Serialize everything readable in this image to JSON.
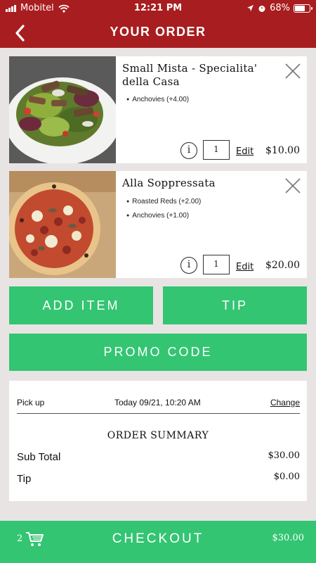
{
  "status_bar": {
    "carrier": "Mobitel",
    "time": "12:21 PM",
    "battery": "68%"
  },
  "header": {
    "title": "YOUR ORDER",
    "back_icon": "chevron-left-icon"
  },
  "cart_items": [
    {
      "name": "Small Mista - Specialita' della Casa",
      "modifiers": [
        "Anchovies (+4.00)"
      ],
      "quantity": "1",
      "edit_label": "Edit",
      "price": "$10.00",
      "image": "salad-photo"
    },
    {
      "name": "Alla Soppressata",
      "modifiers": [
        "Roasted Reds (+2.00)",
        "Anchovies (+1.00)"
      ],
      "quantity": "1",
      "edit_label": "Edit",
      "price": "$20.00",
      "image": "pizza-photo"
    }
  ],
  "buttons": {
    "add_item": "ADD ITEM",
    "tip": "TIP",
    "promo_code": "PROMO CODE"
  },
  "summary": {
    "pickup_label": "Pick up",
    "pickup_time": "Today 09/21, 10:20 AM",
    "change_label": "Change",
    "title": "ORDER SUMMARY",
    "rows": [
      {
        "label": "Sub Total",
        "value": "$30.00"
      },
      {
        "label": "Tip",
        "value": "$0.00"
      }
    ]
  },
  "checkout": {
    "cart_count": "2",
    "label": "CHECKOUT",
    "total": "$30.00"
  },
  "colors": {
    "header_red": "#a81d1f",
    "accent_green": "#33c572",
    "background": "#e8e4e3"
  }
}
